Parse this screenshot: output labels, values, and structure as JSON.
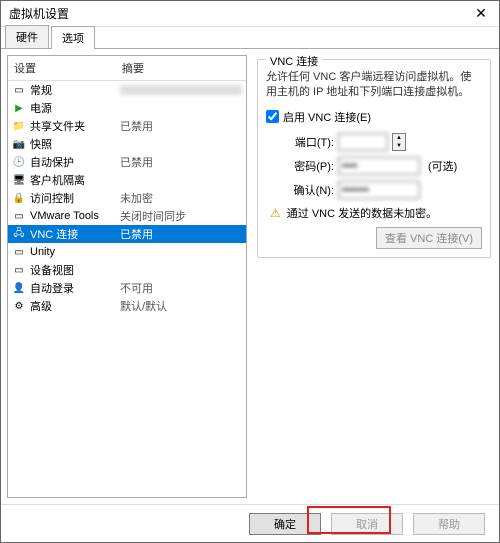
{
  "window": {
    "title": "虚拟机设置"
  },
  "tabs": {
    "hardware": "硬件",
    "options": "选项"
  },
  "left": {
    "header_setting": "设置",
    "header_summary": "摘要",
    "items": [
      {
        "name": "常规",
        "summary_blur": true
      },
      {
        "name": "电源",
        "summary": ""
      },
      {
        "name": "共享文件夹",
        "summary": "已禁用"
      },
      {
        "name": "快照",
        "summary": ""
      },
      {
        "name": "自动保护",
        "summary": "已禁用"
      },
      {
        "name": "客户机隔离",
        "summary": ""
      },
      {
        "name": "访问控制",
        "summary": "未加密"
      },
      {
        "name": "VMware Tools",
        "summary": "关闭时间同步"
      },
      {
        "name": "VNC 连接",
        "summary": "已禁用"
      },
      {
        "name": "Unity",
        "summary": ""
      },
      {
        "name": "设备视图",
        "summary": ""
      },
      {
        "name": "自动登录",
        "summary": "不可用"
      },
      {
        "name": "高级",
        "summary": "默认/默认"
      }
    ]
  },
  "right": {
    "group_title": "VNC 连接",
    "description": "允许任何 VNC 客户端远程访问虚拟机。使用主机的 IP 地址和下列端口连接虚拟机。",
    "enable_label": "启用 VNC 连接(E)",
    "port_label": "端口(T):",
    "port_value": "",
    "password_label": "密码(P):",
    "password_value": "••••",
    "password_optional": "(可选)",
    "confirm_label": "确认(N):",
    "confirm_value": "•••••••",
    "warning_text": "通过 VNC 发送的数据未加密。",
    "view_connections": "查看 VNC 连接(V)"
  },
  "footer": {
    "ok": "确定",
    "cancel": "取消",
    "help": "帮助"
  }
}
